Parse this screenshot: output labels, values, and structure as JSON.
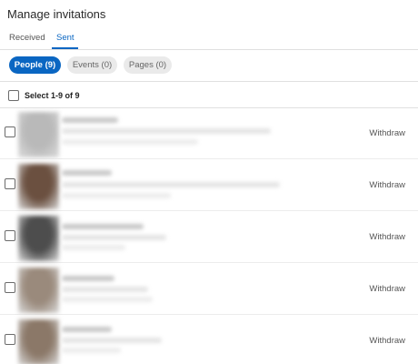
{
  "header": {
    "title": "Manage invitations"
  },
  "tabs": [
    {
      "label": "Received",
      "active": false
    },
    {
      "label": "Sent",
      "active": true
    }
  ],
  "filters": [
    {
      "label": "People (9)",
      "active": true
    },
    {
      "label": "Events (0)",
      "active": false
    },
    {
      "label": "Pages (0)",
      "active": false
    }
  ],
  "select_all": {
    "label": "Select 1-9 of 9",
    "checked": false
  },
  "rows": [
    {
      "action": "Withdraw",
      "checked": false,
      "avatar_color": "#b9b9b9"
    },
    {
      "action": "Withdraw",
      "checked": false,
      "avatar_color": "#6b5040"
    },
    {
      "action": "Withdraw",
      "checked": false,
      "avatar_color": "#4d4d4d"
    },
    {
      "action": "Withdraw",
      "checked": false,
      "avatar_color": "#9a8a7c"
    },
    {
      "action": "Withdraw",
      "checked": false,
      "avatar_color": "#8b7868"
    }
  ],
  "colors": {
    "accent": "#0a66c2",
    "pill_inactive": "#eaeaea",
    "divider": "#e0e0e0"
  }
}
